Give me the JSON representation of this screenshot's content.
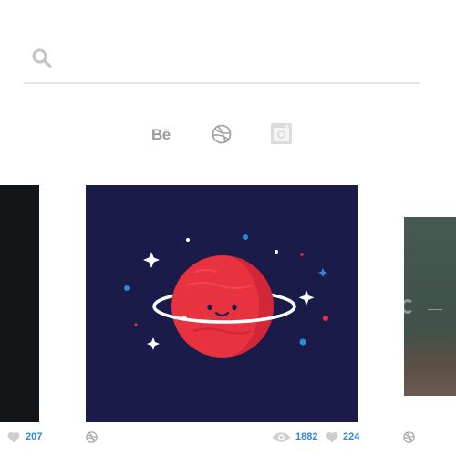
{
  "search": {
    "placeholder": "",
    "value": ""
  },
  "social": {
    "behance_label": "Bē",
    "icons": [
      "behance-icon",
      "dribbble-icon",
      "instagram-icon"
    ]
  },
  "shots": {
    "left": {
      "likes": "207"
    },
    "main": {
      "views": "1882",
      "likes": "224",
      "colors": {
        "background": "#1a1b49",
        "planet": "#e8323f",
        "ring": "#ffffff"
      }
    },
    "right": {}
  },
  "colors": {
    "accent": "#2a8ad9",
    "icon_gray": "#cfcfcf",
    "divider": "#e6e6e6"
  }
}
